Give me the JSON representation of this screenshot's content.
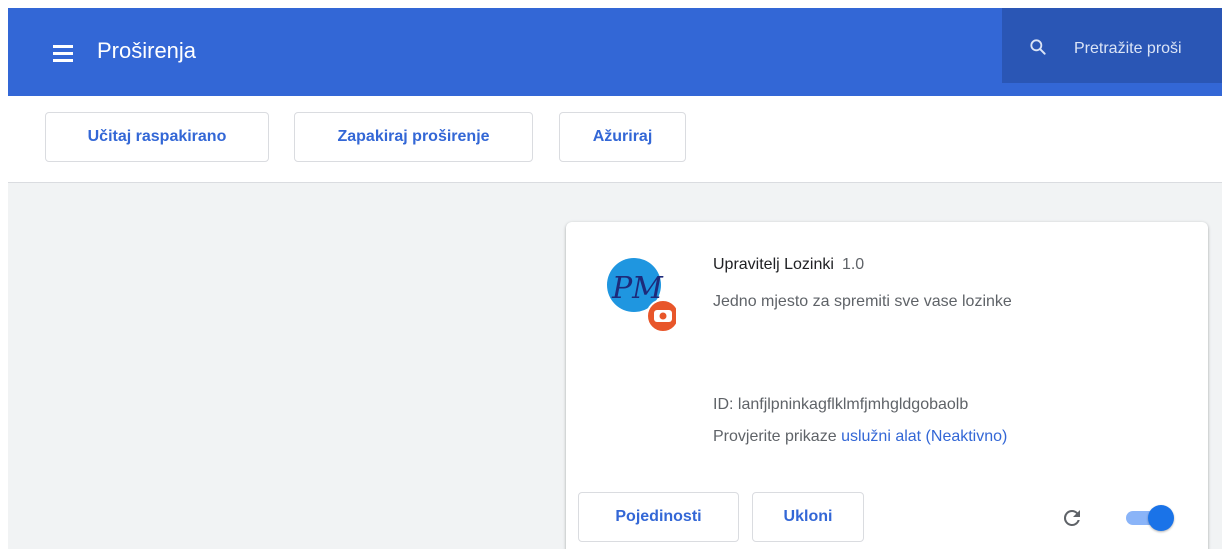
{
  "header": {
    "title": "Proširenja",
    "search_placeholder": "Pretražite proši"
  },
  "toolbar": {
    "load_unpacked_label": "Učitaj raspakirano",
    "pack_extension_label": "Zapakiraj proširenje",
    "update_label": "Ažuriraj"
  },
  "extension": {
    "name": "Upravitelj Lozinki",
    "version": "1.0",
    "description": "Jedno mjesto za spremiti sve vase lozinke",
    "id_text": "ID: lanfjlpninkagflklmfjmhgldgobaolb",
    "inspect_prefix": "Provjerite prikaze",
    "inspect_link": "uslužni alat (Neaktivno)",
    "icon_text": "PM",
    "details_label": "Pojedinosti",
    "remove_label": "Ukloni",
    "enabled": true
  },
  "colors": {
    "header_bg": "#3367d6",
    "accent": "#3367d6",
    "badge": "#e8562a"
  },
  "icons": {
    "menu": "menu-icon",
    "search": "search-icon",
    "reload": "reload-icon",
    "badge": "youtube-badge-icon"
  }
}
